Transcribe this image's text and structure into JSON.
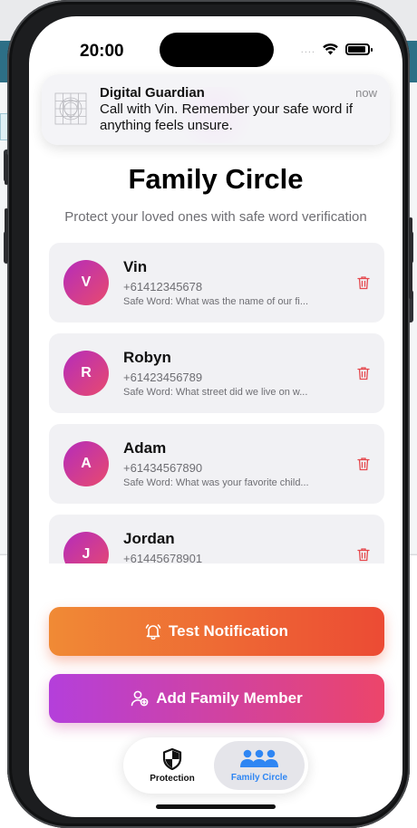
{
  "status": {
    "time": "20:00",
    "signal": "....",
    "wifi_icon": "wifi-icon",
    "battery_icon": "battery-icon"
  },
  "notification": {
    "app": "Digital Guardian",
    "time": "now",
    "message": "Call with Vin. Remember your safe word if anything feels unsure."
  },
  "header": {
    "title": "Family Circle",
    "subtitle": "Protect your loved ones with safe word verification"
  },
  "members": [
    {
      "initial": "V",
      "name": "Vin",
      "phone": "+61412345678",
      "safe_word": "Safe Word: What was the name of our fi..."
    },
    {
      "initial": "R",
      "name": "Robyn",
      "phone": "+61423456789",
      "safe_word": "Safe Word: What street did we live on w..."
    },
    {
      "initial": "A",
      "name": "Adam",
      "phone": "+61434567890",
      "safe_word": "Safe Word: What was your favorite child..."
    },
    {
      "initial": "J",
      "name": "Jordan",
      "phone": "+61445678901",
      "safe_word": ""
    }
  ],
  "actions": {
    "test_notification": "Test Notification",
    "add_family_member": "Add Family Member"
  },
  "tabs": {
    "protection": "Protection",
    "family_circle": "Family Circle",
    "active": "family_circle"
  },
  "colors": {
    "accent_blue": "#2f86f3",
    "delete_red": "#e5484d",
    "test_gradient": [
      "#f08a35",
      "#ec4b34"
    ],
    "add_gradient": [
      "#b43fdb",
      "#ec456a"
    ],
    "avatar_gradient": [
      "#b52cbb",
      "#e84a6e"
    ]
  }
}
